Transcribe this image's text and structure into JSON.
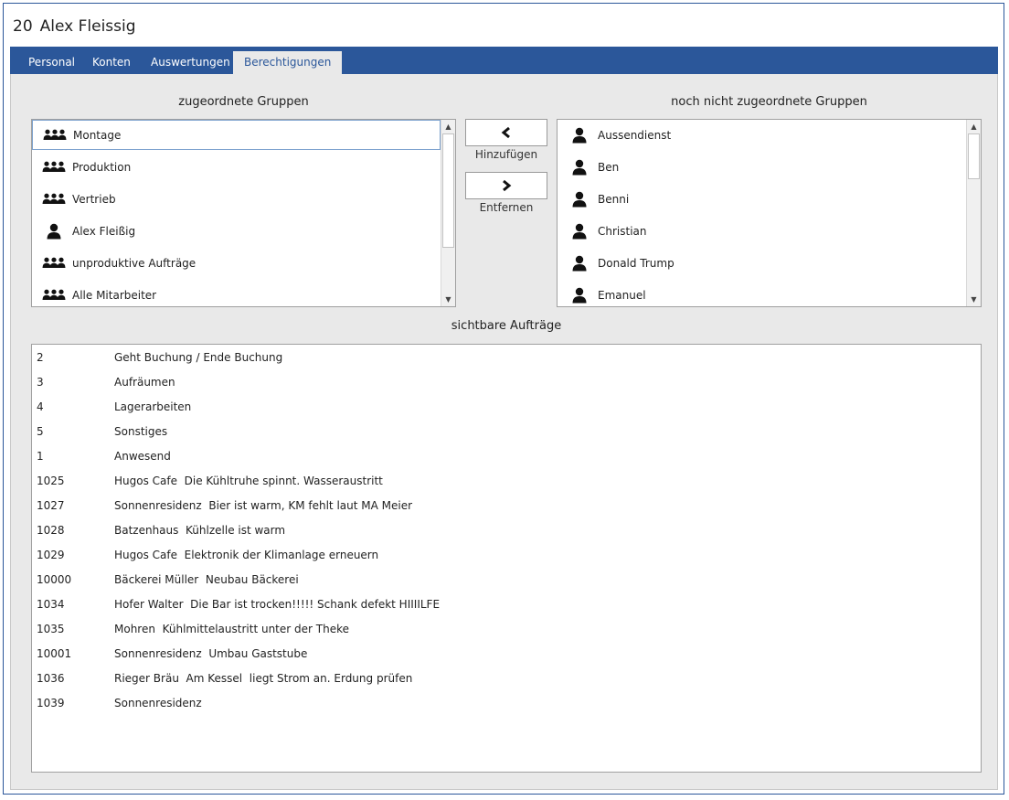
{
  "header": {
    "id": "20",
    "name": "Alex Fleissig"
  },
  "tabs": [
    {
      "label": "Personal"
    },
    {
      "label": "Konten"
    },
    {
      "label": "Auswertungen"
    },
    {
      "label": "Berechtigungen"
    }
  ],
  "assigned": {
    "title": "zugeordnete Gruppen",
    "items": [
      {
        "label": "Montage",
        "icon": "group-icon"
      },
      {
        "label": "Produktion",
        "icon": "group-icon"
      },
      {
        "label": "Vertrieb",
        "icon": "group-icon"
      },
      {
        "label": "Alex Fleißig",
        "icon": "user-icon"
      },
      {
        "label": "unproduktive Aufträge",
        "icon": "group-icon"
      },
      {
        "label": "Alle Mitarbeiter",
        "icon": "group-icon"
      }
    ]
  },
  "unassigned": {
    "title": "noch nicht zugeordnete Gruppen",
    "items": [
      {
        "label": "Aussendienst",
        "icon": "user-icon"
      },
      {
        "label": "Ben",
        "icon": "user-icon"
      },
      {
        "label": "Benni",
        "icon": "user-icon"
      },
      {
        "label": "Christian",
        "icon": "user-icon"
      },
      {
        "label": "Donald Trump",
        "icon": "user-icon"
      },
      {
        "label": "Emanuel",
        "icon": "user-icon"
      }
    ]
  },
  "actions": {
    "add_label": "Hinzufügen",
    "remove_label": "Entfernen"
  },
  "orders": {
    "title": "sichtbare Aufträge",
    "rows": [
      {
        "num": "2",
        "text": "Geht Buchung / Ende Buchung"
      },
      {
        "num": "3",
        "text": "Aufräumen"
      },
      {
        "num": "4",
        "text": "Lagerarbeiten"
      },
      {
        "num": "5",
        "text": "Sonstiges"
      },
      {
        "num": "1",
        "text": "Anwesend"
      },
      {
        "num": "1025",
        "text": "Hugos Cafe  Die Kühltruhe spinnt. Wasseraustritt"
      },
      {
        "num": "1027",
        "text": "Sonnenresidenz  Bier ist warm, KM fehlt laut MA Meier"
      },
      {
        "num": "1028",
        "text": "Batzenhaus  Kühlzelle ist warm"
      },
      {
        "num": "1029",
        "text": "Hugos Cafe  Elektronik der Klimanlage erneuern"
      },
      {
        "num": "10000",
        "text": "Bäckerei Müller  Neubau Bäckerei"
      },
      {
        "num": "1034",
        "text": "Hofer Walter  Die Bar ist trocken!!!!! Schank defekt HIIIILFE"
      },
      {
        "num": "1035",
        "text": "Mohren  Kühlmittelaustritt unter der Theke"
      },
      {
        "num": "10001",
        "text": "Sonnenresidenz  Umbau Gaststube"
      },
      {
        "num": "1036",
        "text": "Rieger Bräu  Am Kessel  liegt Strom an. Erdung prüfen"
      },
      {
        "num": "1039",
        "text": "Sonnenresidenz"
      }
    ]
  }
}
